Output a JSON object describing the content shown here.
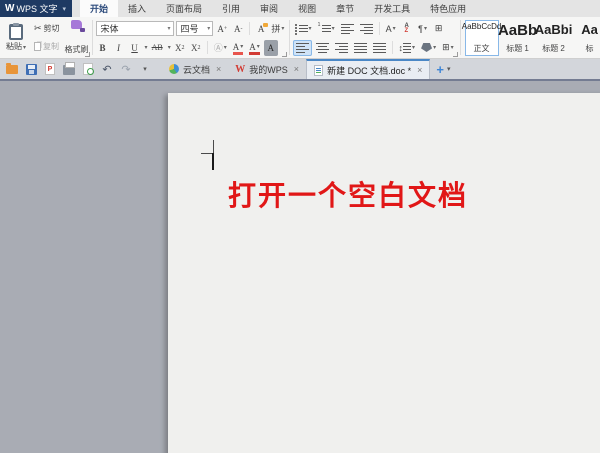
{
  "titlebar": {
    "app_name": "WPS 文字",
    "logo": "W",
    "tabs": [
      {
        "label": "开始",
        "active": true
      },
      {
        "label": "插入",
        "active": false
      },
      {
        "label": "页面布局",
        "active": false
      },
      {
        "label": "引用",
        "active": false
      },
      {
        "label": "审阅",
        "active": false
      },
      {
        "label": "视图",
        "active": false
      },
      {
        "label": "章节",
        "active": false
      },
      {
        "label": "开发工具",
        "active": false
      },
      {
        "label": "特色应用",
        "active": false
      }
    ]
  },
  "ribbon": {
    "clipboard": {
      "paste": "粘贴",
      "cut": "剪切",
      "copy": "复制",
      "format_painter": "格式刷"
    },
    "font": {
      "font_name": "宋体",
      "font_size": "四号",
      "grow": "A",
      "grow_sign": "+",
      "shrink": "A",
      "shrink_sign": "-",
      "clear_format": "A",
      "pinyin": "拼",
      "bold": "B",
      "italic": "I",
      "underline": "U",
      "strikethrough": "AB",
      "superscript_base": "X",
      "superscript_mark": "2",
      "subscript_base": "X",
      "subscript_mark": "2",
      "enclose": "Ⓐ",
      "highlight": "A",
      "font_color": "A",
      "char_shading": "A"
    },
    "paragraph": {
      "char_layout": "A",
      "sort_a": "A",
      "sort_z": "Z",
      "para_mark": "¶",
      "table": "⊞",
      "line_spacing_arrow": "↕",
      "borders": "⊞"
    },
    "styles": [
      {
        "preview": "AaBbCcDd",
        "label": "正文",
        "selected": true
      },
      {
        "preview": "AaBb",
        "label": "标题 1",
        "selected": false
      },
      {
        "preview": "AaBbi",
        "label": "标题 2",
        "selected": false
      },
      {
        "preview": "Aa",
        "label": "标",
        "selected": false
      }
    ]
  },
  "tabstrip": {
    "tabs": [
      {
        "label": "云文档",
        "active": false
      },
      {
        "label": "我的WPS",
        "active": false
      },
      {
        "label": "新建 DOC 文档.doc *",
        "active": true
      }
    ]
  },
  "document": {
    "annotation": "打开一个空白文档",
    "annotation_color": "#e11717"
  },
  "icons": {
    "scissors": "✂",
    "undo": "↶",
    "redo": "↷",
    "dropdown": "▾",
    "close": "×",
    "plus": "+"
  },
  "colors": {
    "wps_navy": "#1e3a63",
    "accent_blue": "#4a87c6",
    "annotation_red": "#e11717",
    "workspace_gray": "#a9acb4",
    "page": "#f0f0ee"
  }
}
